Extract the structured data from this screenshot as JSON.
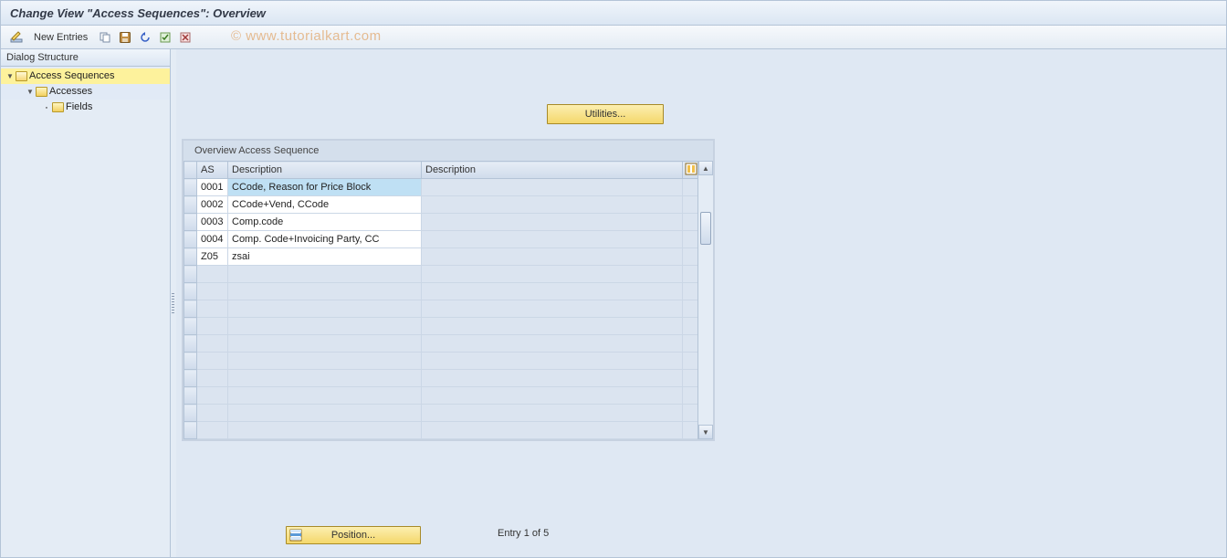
{
  "title": "Change View \"Access Sequences\": Overview",
  "toolbar": {
    "new_entries_label": "New Entries"
  },
  "watermark": "© www.tutorialkart.com",
  "sidebar": {
    "header": "Dialog Structure",
    "items": [
      {
        "label": "Access Sequences"
      },
      {
        "label": "Accesses"
      },
      {
        "label": "Fields"
      }
    ]
  },
  "utilities_label": "Utilities...",
  "table": {
    "title": "Overview Access Sequence",
    "columns": [
      "AS",
      "Description",
      "Description"
    ],
    "rows": [
      {
        "as": "0001",
        "desc": "CCode, Reason for Price Block",
        "selected": true
      },
      {
        "as": "0002",
        "desc": "CCode+Vend, CCode"
      },
      {
        "as": "0003",
        "desc": "Comp.code"
      },
      {
        "as": "0004",
        "desc": "Comp. Code+Invoicing Party, CC"
      },
      {
        "as": "Z05",
        "desc": "zsai"
      }
    ],
    "blank_rows": 10
  },
  "position_label": "Position...",
  "entry_status": "Entry 1 of 5"
}
